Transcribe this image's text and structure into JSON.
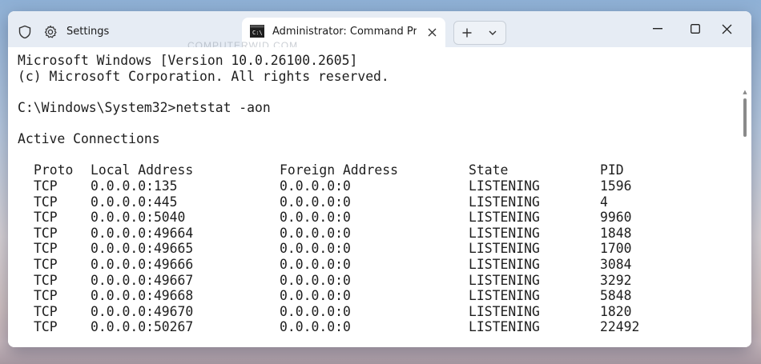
{
  "tabs": [
    {
      "label": "Settings",
      "icon": "gear-icon",
      "active": false
    },
    {
      "label": "Administrator: Command Pro",
      "icon": "terminal-icon",
      "active": true
    }
  ],
  "tab_actions": {
    "new_tab": "+",
    "dropdown": "chevron-down-icon"
  },
  "window_controls": {
    "minimize": "minimize-icon",
    "maximize": "maximize-icon",
    "close": "close-icon"
  },
  "watermark": "COMPUTERWID.COM",
  "terminal": {
    "banner_line1": "Microsoft Windows [Version 10.0.26100.2605]",
    "banner_line2": "(c) Microsoft Corporation. All rights reserved.",
    "prompt_command": "C:\\Windows\\System32>netstat -aon",
    "section_title": "Active Connections",
    "headers": {
      "proto": "Proto",
      "local": "Local Address",
      "foreign": "Foreign Address",
      "state": "State",
      "pid": "PID"
    },
    "rows": [
      {
        "proto": "TCP",
        "local": "0.0.0.0:135",
        "foreign": "0.0.0.0:0",
        "state": "LISTENING",
        "pid": "1596"
      },
      {
        "proto": "TCP",
        "local": "0.0.0.0:445",
        "foreign": "0.0.0.0:0",
        "state": "LISTENING",
        "pid": "4"
      },
      {
        "proto": "TCP",
        "local": "0.0.0.0:5040",
        "foreign": "0.0.0.0:0",
        "state": "LISTENING",
        "pid": "9960"
      },
      {
        "proto": "TCP",
        "local": "0.0.0.0:49664",
        "foreign": "0.0.0.0:0",
        "state": "LISTENING",
        "pid": "1848"
      },
      {
        "proto": "TCP",
        "local": "0.0.0.0:49665",
        "foreign": "0.0.0.0:0",
        "state": "LISTENING",
        "pid": "1700"
      },
      {
        "proto": "TCP",
        "local": "0.0.0.0:49666",
        "foreign": "0.0.0.0:0",
        "state": "LISTENING",
        "pid": "3084"
      },
      {
        "proto": "TCP",
        "local": "0.0.0.0:49667",
        "foreign": "0.0.0.0:0",
        "state": "LISTENING",
        "pid": "3292"
      },
      {
        "proto": "TCP",
        "local": "0.0.0.0:49668",
        "foreign": "0.0.0.0:0",
        "state": "LISTENING",
        "pid": "5848"
      },
      {
        "proto": "TCP",
        "local": "0.0.0.0:49670",
        "foreign": "0.0.0.0:0",
        "state": "LISTENING",
        "pid": "1820"
      },
      {
        "proto": "TCP",
        "local": "0.0.0.0:50267",
        "foreign": "0.0.0.0:0",
        "state": "LISTENING",
        "pid": "22492"
      }
    ]
  }
}
